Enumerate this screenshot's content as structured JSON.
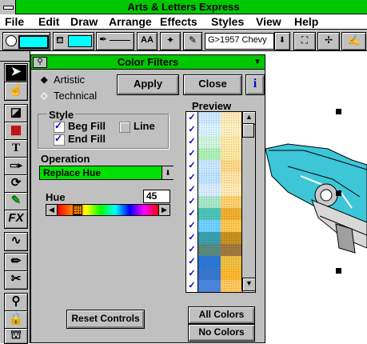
{
  "app": {
    "title": "Arts & Letters Express"
  },
  "menu": [
    "File",
    "Edit",
    "Draw",
    "Arrange",
    "Effects",
    "Styles",
    "View",
    "Help"
  ],
  "toolbar": {
    "font_button": "AA",
    "style_combo": "G>1957 Chevy"
  },
  "dialog": {
    "title": "Color Filters",
    "mode_artistic": "Artistic",
    "mode_technical": "Technical",
    "apply_label": "Apply",
    "close_label": "Close",
    "info_label": "i",
    "style_group": "Style",
    "beg_fill": "Beg Fill",
    "line": "Line",
    "end_fill": "End Fill",
    "operation_label": "Operation",
    "operation_value": "Replace Hue",
    "hue_label": "Hue",
    "hue_value": "45",
    "preview_label": "Preview",
    "reset_label": "Reset Controls",
    "all_colors_label": "All Colors",
    "no_colors_label": "No Colors"
  },
  "colors": {
    "accent": "#00c800",
    "operation_bg": "#00e000"
  },
  "preview": {
    "rows": [
      {
        "left": "#cfe9ff",
        "right": "#ffe9b8"
      },
      {
        "left": "#d9f2ff",
        "right": "#ffefc0"
      },
      {
        "left": "#cff5e0",
        "right": "#ffe8a8"
      },
      {
        "left": "#aef0b8",
        "right": "#ffe6a0"
      },
      {
        "left": "#c8e8ff",
        "right": "#ffd98a"
      },
      {
        "left": "#bfe4ff",
        "right": "#ffe4a4"
      },
      {
        "left": "#d9ecff",
        "right": "#ffeab0"
      },
      {
        "left": "#a8e8c8",
        "right": "#ffd070"
      },
      {
        "left": "#4ec4b8",
        "right": "#f0b030"
      },
      {
        "left": "#70d0ff",
        "right": "#ffc850"
      },
      {
        "left": "#38a0b0",
        "right": "#c89020"
      },
      {
        "left": "#5a8a80",
        "right": "#a07840"
      },
      {
        "left": "#2c78d8",
        "right": "#f0c040"
      },
      {
        "left": "#3878d0",
        "right": "#ffb830"
      },
      {
        "left": "#4c86e0",
        "right": "#ffc860"
      }
    ]
  }
}
